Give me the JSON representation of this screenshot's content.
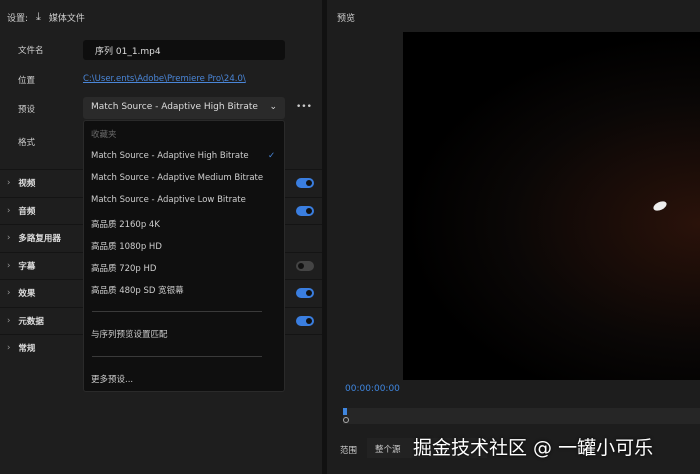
{
  "header": {
    "settings_label": "设置:",
    "media_label": "媒体文件"
  },
  "form": {
    "filename_label": "文件名",
    "filename_value": "序列 01_1.mp4",
    "location_label": "位置",
    "location_value": "C:\\User.ents\\Adobe\\Premiere Pro\\24.0\\",
    "preset_label": "预设",
    "preset_value": "Match Source - Adaptive High Bitrate",
    "format_label": "格式",
    "more": "•••"
  },
  "sections": [
    {
      "label": "视频",
      "toggle": true
    },
    {
      "label": "音频",
      "toggle": true
    },
    {
      "label": "多路复用器",
      "toggle": null
    },
    {
      "label": "字幕",
      "toggle": false
    },
    {
      "label": "效果",
      "toggle": true
    },
    {
      "label": "元数据",
      "toggle": true
    },
    {
      "label": "常规",
      "toggle": null
    }
  ],
  "menu": {
    "header": "收藏夹",
    "items": [
      "Match Source - Adaptive High Bitrate",
      "Match Source - Adaptive Medium Bitrate",
      "Match Source - Adaptive Low Bitrate",
      "高品质 2160p 4K",
      "高品质 1080p HD",
      "高品质 720p HD",
      "高品质 480p SD 宽银幕"
    ],
    "selected": 0,
    "match": "与序列预览设置匹配",
    "more": "更多预设..."
  },
  "preview": {
    "title": "预览",
    "timecode": "00:00:00:00",
    "range_label": "范围",
    "range_value": "整个源"
  },
  "watermark": "掘金技术社区 @ 一罐小可乐"
}
